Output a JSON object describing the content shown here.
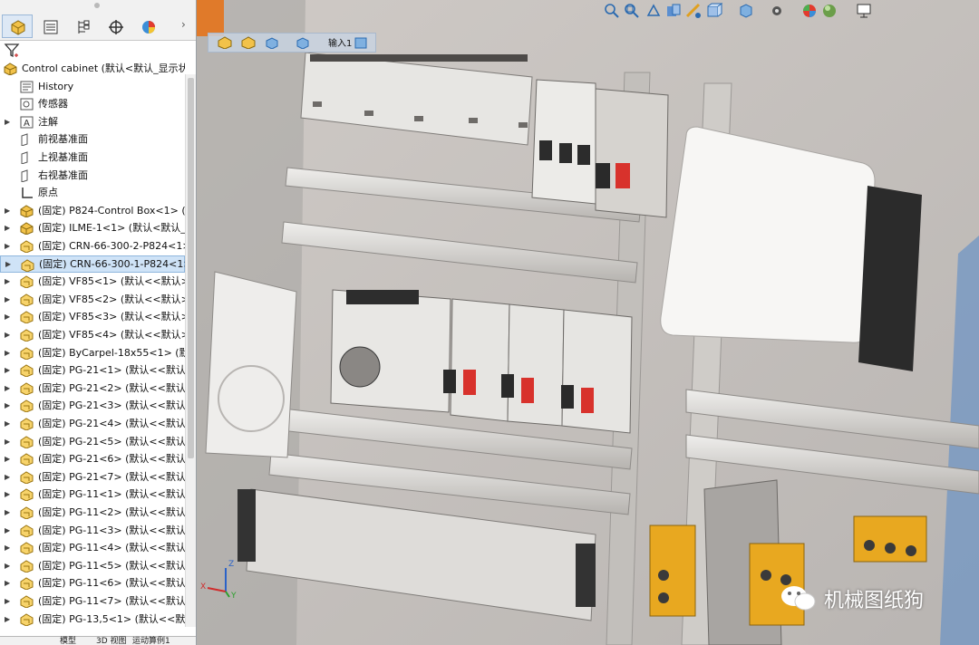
{
  "panel": {
    "tabs": [
      "feature-manager-icon",
      "property-manager-icon",
      "configuration-manager-icon",
      "dimxpert-icon",
      "display-manager-icon"
    ],
    "tree": [
      {
        "label": "Control cabinet  (默认<默认_显示状",
        "icon": "assembly-icon",
        "expand": "",
        "indent": 0
      },
      {
        "label": "History",
        "icon": "history-icon",
        "expand": "",
        "indent": 1
      },
      {
        "label": "传感器",
        "icon": "sensor-icon",
        "expand": "",
        "indent": 1
      },
      {
        "label": "注解",
        "icon": "annotation-icon",
        "expand": "▶",
        "indent": 1
      },
      {
        "label": "前视基准面",
        "icon": "plane-icon",
        "expand": "",
        "indent": 1
      },
      {
        "label": "上视基准面",
        "icon": "plane-icon",
        "expand": "",
        "indent": 1
      },
      {
        "label": "右视基准面",
        "icon": "plane-icon",
        "expand": "",
        "indent": 1
      },
      {
        "label": "原点",
        "icon": "origin-icon",
        "expand": "",
        "indent": 1
      },
      {
        "label": "(固定) P824-Control Box<1> (默",
        "icon": "assembly-icon",
        "expand": "▶",
        "indent": 1
      },
      {
        "label": "(固定) ILME-1<1> (默认<默认_显",
        "icon": "assembly-icon",
        "expand": "▶",
        "indent": 1
      },
      {
        "label": "(固定) CRN-66-300-2-P824<1>",
        "icon": "part-icon",
        "expand": "▶",
        "indent": 1
      },
      {
        "label": "(固定) CRN-66-300-1-P824<1>",
        "icon": "part-icon",
        "expand": "▶",
        "indent": 1,
        "selected": true
      },
      {
        "label": "(固定) VF85<1> (默认<<默认>_",
        "icon": "part-icon",
        "expand": "▶",
        "indent": 1
      },
      {
        "label": "(固定) VF85<2> (默认<<默认>_",
        "icon": "part-icon",
        "expand": "▶",
        "indent": 1
      },
      {
        "label": "(固定) VF85<3> (默认<<默认>_",
        "icon": "part-icon",
        "expand": "▶",
        "indent": 1
      },
      {
        "label": "(固定) VF85<4> (默认<<默认>_",
        "icon": "part-icon",
        "expand": "▶",
        "indent": 1
      },
      {
        "label": "(固定) ByCarpel-18x55<1> (默认",
        "icon": "part-icon",
        "expand": "▶",
        "indent": 1
      },
      {
        "label": "(固定) PG-21<1> (默认<<默认>",
        "icon": "part-icon",
        "expand": "▶",
        "indent": 1
      },
      {
        "label": "(固定) PG-21<2> (默认<<默认>",
        "icon": "part-icon",
        "expand": "▶",
        "indent": 1
      },
      {
        "label": "(固定) PG-21<3> (默认<<默认>",
        "icon": "part-icon",
        "expand": "▶",
        "indent": 1
      },
      {
        "label": "(固定) PG-21<4> (默认<<默认>",
        "icon": "part-icon",
        "expand": "▶",
        "indent": 1
      },
      {
        "label": "(固定) PG-21<5> (默认<<默认>",
        "icon": "part-icon",
        "expand": "▶",
        "indent": 1
      },
      {
        "label": "(固定) PG-21<6> (默认<<默认>",
        "icon": "part-icon",
        "expand": "▶",
        "indent": 1
      },
      {
        "label": "(固定) PG-21<7> (默认<<默认>",
        "icon": "part-icon",
        "expand": "▶",
        "indent": 1
      },
      {
        "label": "(固定) PG-11<1> (默认<<默认>",
        "icon": "part-icon",
        "expand": "▶",
        "indent": 1
      },
      {
        "label": "(固定) PG-11<2> (默认<<默认>",
        "icon": "part-icon",
        "expand": "▶",
        "indent": 1
      },
      {
        "label": "(固定) PG-11<3> (默认<<默认>",
        "icon": "part-icon",
        "expand": "▶",
        "indent": 1
      },
      {
        "label": "(固定) PG-11<4> (默认<<默认>",
        "icon": "part-icon",
        "expand": "▶",
        "indent": 1
      },
      {
        "label": "(固定) PG-11<5> (默认<<默认>",
        "icon": "part-icon",
        "expand": "▶",
        "indent": 1
      },
      {
        "label": "(固定) PG-11<6> (默认<<默认>",
        "icon": "part-icon",
        "expand": "▶",
        "indent": 1
      },
      {
        "label": "(固定) PG-11<7> (默认<<默认>",
        "icon": "part-icon",
        "expand": "▶",
        "indent": 1
      },
      {
        "label": "(固定) PG-13,5<1> (默认<<默认",
        "icon": "part-icon",
        "expand": "▶",
        "indent": 1
      }
    ],
    "bottom_tabs": [
      "模型",
      "3D 视图",
      "运动算例1"
    ]
  },
  "viewport": {
    "hud_icons": [
      "zoom-to-fit-icon",
      "zoom-area-icon",
      "previous-view-icon",
      "section-view-icon",
      "dynamic-annotation-icon",
      "view-orientation-icon",
      "display-style-icon",
      "hide-show-icon",
      "edit-appearance-icon",
      "scene-icon",
      "view-settings-icon"
    ],
    "breadcrumb": {
      "icons": [
        "assembly-icon",
        "part-icon",
        "part-body-icon",
        "feature-icon",
        "sketch-icon"
      ],
      "text": "输入1"
    },
    "triad": {
      "x": "X",
      "y": "Y",
      "z": "Z"
    },
    "watermark": "机械图纸狗",
    "colors": {
      "terminal_red": "#d8322c",
      "terminal_yellow": "#e8a820",
      "cabinet_gray": "#c9c6c2",
      "selection_blue": "#cfe3f7"
    }
  }
}
